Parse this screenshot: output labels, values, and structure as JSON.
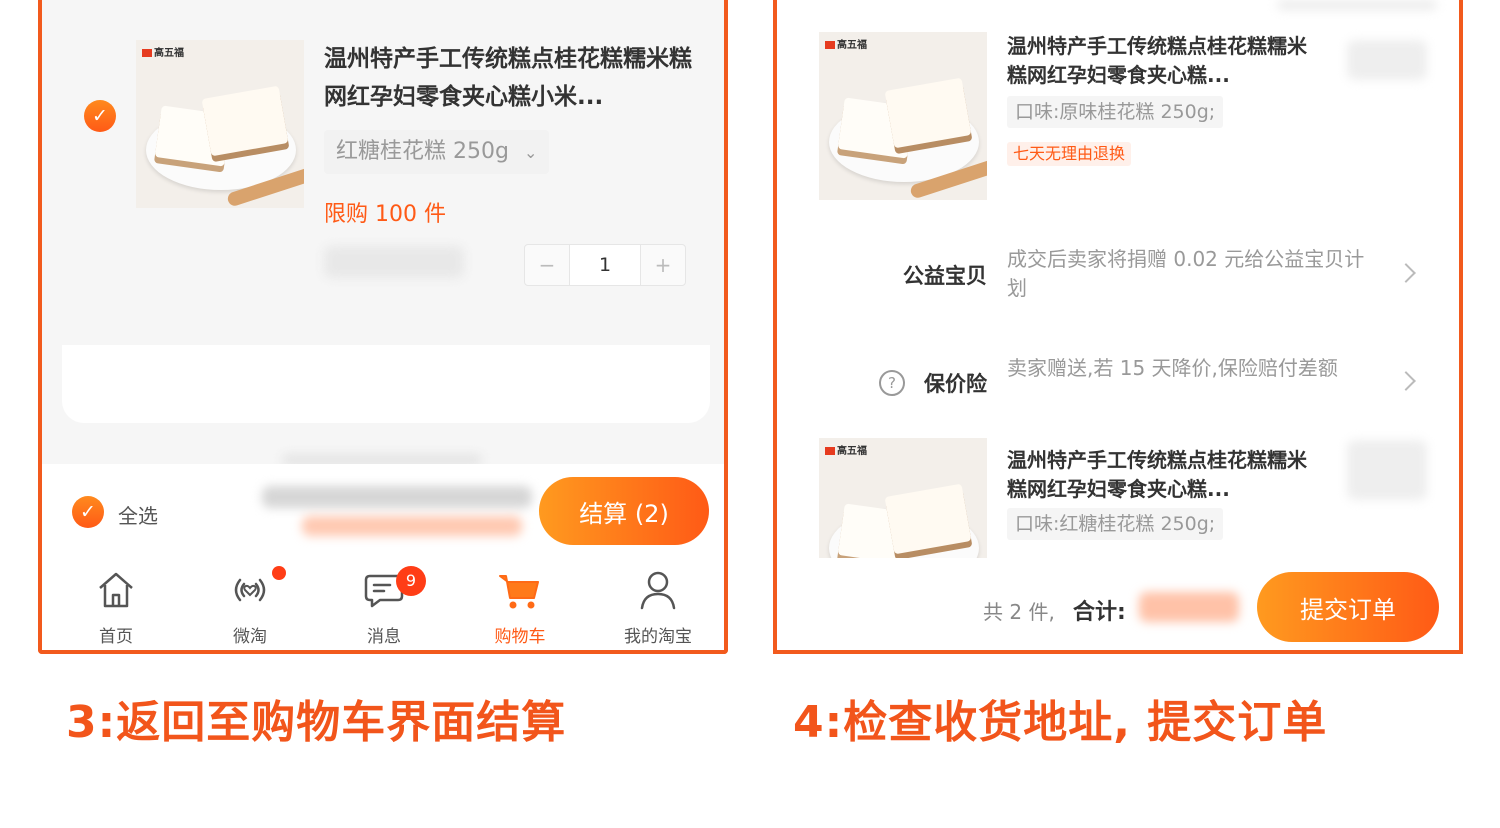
{
  "colors": {
    "accent": "#f25a1d",
    "button_gradient_start": "#ff9a1f",
    "button_gradient_end": "#ff5a16"
  },
  "left_screen": {
    "cart_item": {
      "title": "温州特产手工传统糕点桂花糕糯米糕网红孕妇零食夹心糕小米...",
      "sku": "红糖桂花糕 250g",
      "sku_chevron": "⌄",
      "limit": "限购 100 件",
      "quantity": "1",
      "minus": "−",
      "plus": "+",
      "logo_text": "高五福"
    },
    "checkout": {
      "select_all": "全选",
      "settle_button": "结算 (2)"
    },
    "tabbar": [
      {
        "label": "首页",
        "icon": "home-icon"
      },
      {
        "label": "微淘",
        "icon": "broadcast-icon"
      },
      {
        "label": "消息",
        "icon": "message-icon",
        "badge": "9"
      },
      {
        "label": "购物车",
        "icon": "cart-icon"
      },
      {
        "label": "我的淘宝",
        "icon": "user-icon"
      }
    ]
  },
  "right_screen": {
    "items": [
      {
        "title": "温州特产手工传统糕点桂花糕糯米糕网红孕妇零食夹心糕...",
        "sku": "口味:原味桂花糕 250g;",
        "tag": "七天无理由退换"
      },
      {
        "title": "温州特产手工传统糕点桂花糕糯米糕网红孕妇零食夹心糕...",
        "sku": "口味:红糖桂花糕 250g;"
      }
    ],
    "charity": {
      "label": "公益宝贝",
      "desc": "成交后卖家将捐赠 0.02 元给公益宝贝计划"
    },
    "insurance": {
      "label": "保价险",
      "help": "?",
      "desc": "卖家赠送,若 15 天降价,保险赔付差额"
    },
    "submit": {
      "count": "共 2 件,",
      "total_label": "合计:",
      "button": "提交订单"
    }
  },
  "captions": {
    "left": "3:返回至购物车界面结算",
    "right": "4:检查收货地址, 提交订单"
  }
}
